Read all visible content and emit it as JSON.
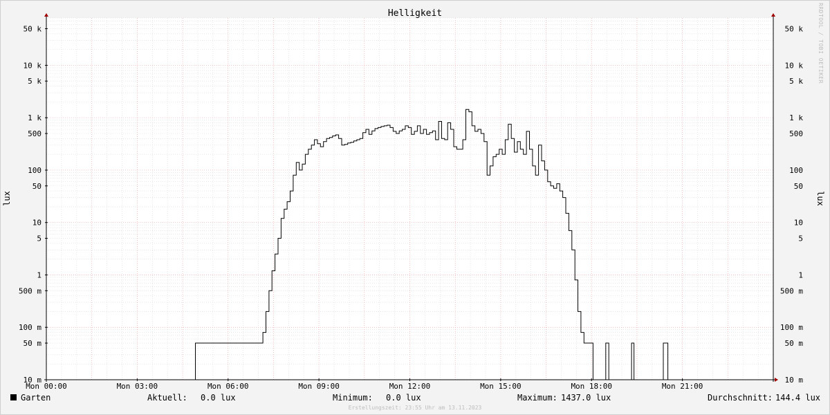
{
  "watermark": "RRDTOOL / TOBI OETIKER",
  "chart_data": {
    "type": "line",
    "title": "Helligkeit",
    "ylabel": "lux",
    "y_scale": "log",
    "ylim": [
      0.01,
      80000
    ],
    "xlim_hours": [
      0,
      24
    ],
    "grid": true,
    "y_ticks": [
      {
        "value": 50000,
        "label": "50 k"
      },
      {
        "value": 10000,
        "label": "10 k"
      },
      {
        "value": 5000,
        "label": "5 k"
      },
      {
        "value": 1000,
        "label": "1 k"
      },
      {
        "value": 500,
        "label": "500"
      },
      {
        "value": 100,
        "label": "100"
      },
      {
        "value": 50,
        "label": "50"
      },
      {
        "value": 10,
        "label": "10"
      },
      {
        "value": 5,
        "label": "5"
      },
      {
        "value": 1,
        "label": "1"
      },
      {
        "value": 0.5,
        "label": "500 m"
      },
      {
        "value": 0.1,
        "label": "100 m"
      },
      {
        "value": 0.05,
        "label": "50 m"
      },
      {
        "value": 0.01,
        "label": "10 m"
      }
    ],
    "x_ticks": [
      {
        "value": 0,
        "label": "Mon 00:00"
      },
      {
        "value": 3,
        "label": "Mon 03:00"
      },
      {
        "value": 6,
        "label": "Mon 06:00"
      },
      {
        "value": 9,
        "label": "Mon 09:00"
      },
      {
        "value": 12,
        "label": "Mon 12:00"
      },
      {
        "value": 15,
        "label": "Mon 15:00"
      },
      {
        "value": 18,
        "label": "Mon 18:00"
      },
      {
        "value": 21,
        "label": "Mon 21:00"
      }
    ],
    "series": [
      {
        "name": "Garten",
        "color": "#000000",
        "points": [
          [
            0,
            0.01
          ],
          [
            4.9,
            0.01
          ],
          [
            4.92,
            0.05
          ],
          [
            7.1,
            0.05
          ],
          [
            7.15,
            0.08
          ],
          [
            7.25,
            0.2
          ],
          [
            7.35,
            0.5
          ],
          [
            7.45,
            1.2
          ],
          [
            7.55,
            2.5
          ],
          [
            7.65,
            5
          ],
          [
            7.75,
            12
          ],
          [
            7.85,
            18
          ],
          [
            7.95,
            25
          ],
          [
            8.05,
            40
          ],
          [
            8.15,
            80
          ],
          [
            8.25,
            140
          ],
          [
            8.35,
            100
          ],
          [
            8.45,
            130
          ],
          [
            8.55,
            200
          ],
          [
            8.65,
            250
          ],
          [
            8.75,
            300
          ],
          [
            8.85,
            380
          ],
          [
            8.95,
            320
          ],
          [
            9.05,
            280
          ],
          [
            9.15,
            350
          ],
          [
            9.25,
            400
          ],
          [
            9.35,
            420
          ],
          [
            9.45,
            450
          ],
          [
            9.55,
            470
          ],
          [
            9.65,
            400
          ],
          [
            9.75,
            300
          ],
          [
            9.85,
            310
          ],
          [
            9.95,
            330
          ],
          [
            10.05,
            340
          ],
          [
            10.15,
            360
          ],
          [
            10.25,
            380
          ],
          [
            10.35,
            400
          ],
          [
            10.45,
            520
          ],
          [
            10.55,
            600
          ],
          [
            10.65,
            480
          ],
          [
            10.75,
            560
          ],
          [
            10.85,
            620
          ],
          [
            10.95,
            650
          ],
          [
            11.05,
            680
          ],
          [
            11.15,
            700
          ],
          [
            11.25,
            720
          ],
          [
            11.35,
            650
          ],
          [
            11.45,
            550
          ],
          [
            11.55,
            500
          ],
          [
            11.65,
            560
          ],
          [
            11.75,
            600
          ],
          [
            11.85,
            700
          ],
          [
            11.95,
            650
          ],
          [
            12.05,
            480
          ],
          [
            12.15,
            550
          ],
          [
            12.25,
            700
          ],
          [
            12.35,
            500
          ],
          [
            12.45,
            600
          ],
          [
            12.55,
            480
          ],
          [
            12.65,
            520
          ],
          [
            12.75,
            560
          ],
          [
            12.85,
            380
          ],
          [
            12.95,
            850
          ],
          [
            13.05,
            400
          ],
          [
            13.15,
            380
          ],
          [
            13.25,
            800
          ],
          [
            13.35,
            600
          ],
          [
            13.45,
            280
          ],
          [
            13.55,
            250
          ],
          [
            13.65,
            250
          ],
          [
            13.75,
            380
          ],
          [
            13.85,
            1437
          ],
          [
            13.95,
            1300
          ],
          [
            14.05,
            700
          ],
          [
            14.15,
            550
          ],
          [
            14.25,
            600
          ],
          [
            14.35,
            500
          ],
          [
            14.45,
            350
          ],
          [
            14.55,
            80
          ],
          [
            14.65,
            120
          ],
          [
            14.75,
            180
          ],
          [
            14.85,
            200
          ],
          [
            14.95,
            250
          ],
          [
            15.05,
            200
          ],
          [
            15.15,
            380
          ],
          [
            15.25,
            750
          ],
          [
            15.35,
            400
          ],
          [
            15.45,
            220
          ],
          [
            15.55,
            350
          ],
          [
            15.65,
            250
          ],
          [
            15.75,
            200
          ],
          [
            15.85,
            550
          ],
          [
            15.95,
            250
          ],
          [
            16.05,
            120
          ],
          [
            16.15,
            80
          ],
          [
            16.25,
            300
          ],
          [
            16.35,
            150
          ],
          [
            16.45,
            100
          ],
          [
            16.55,
            60
          ],
          [
            16.65,
            50
          ],
          [
            16.75,
            45
          ],
          [
            16.85,
            55
          ],
          [
            16.95,
            40
          ],
          [
            17.05,
            30
          ],
          [
            17.15,
            15
          ],
          [
            17.25,
            7
          ],
          [
            17.35,
            3
          ],
          [
            17.45,
            0.8
          ],
          [
            17.55,
            0.2
          ],
          [
            17.65,
            0.08
          ],
          [
            17.75,
            0.05
          ],
          [
            17.95,
            0.05
          ],
          [
            18.05,
            0.01
          ],
          [
            18.45,
            0.01
          ],
          [
            18.47,
            0.05
          ],
          [
            18.55,
            0.05
          ],
          [
            18.57,
            0.01
          ],
          [
            19.3,
            0.01
          ],
          [
            19.32,
            0.05
          ],
          [
            19.38,
            0.05
          ],
          [
            19.4,
            0.01
          ],
          [
            20.35,
            0.01
          ],
          [
            20.37,
            0.05
          ],
          [
            20.5,
            0.05
          ],
          [
            20.52,
            0.01
          ],
          [
            24,
            0.01
          ]
        ]
      }
    ]
  },
  "legend": {
    "series_name": "Garten",
    "current_label": "Aktuell:",
    "current_value": "0.0 lux",
    "min_label": "Minimum:",
    "min_value": "0.0 lux",
    "max_label": "Maximum:",
    "max_value": "1437.0 lux",
    "avg_label": "Durchschnitt:",
    "avg_value": "144.4 lux"
  },
  "footer": "Erstellungszeit: 23:55 Uhr am 13.11.2023"
}
